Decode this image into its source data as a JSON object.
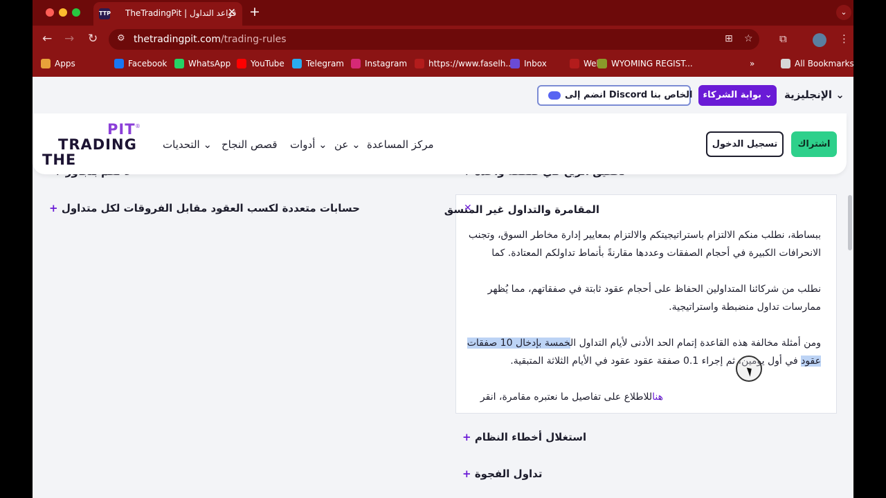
{
  "browser": {
    "tab_title": "TheTradingPit | قواعد التداول",
    "tab_favicon": "TTP",
    "url_host": "thetradingpit.com",
    "url_path": "/trading-rules",
    "bookmarks": [
      {
        "label": "Apps",
        "icon": "apps-icon",
        "color": "#e8a23a"
      },
      {
        "label": "Facebook",
        "icon": "facebook-icon",
        "color": "#1877f2"
      },
      {
        "label": "WhatsApp",
        "icon": "whatsapp-icon",
        "color": "#25d366"
      },
      {
        "label": "YouTube",
        "icon": "youtube-icon",
        "color": "#ff0000"
      },
      {
        "label": "Telegram",
        "icon": "telegram-icon",
        "color": "#2aabee"
      },
      {
        "label": "Instagram",
        "icon": "instagram-icon",
        "color": "#d62976"
      },
      {
        "label": "https://www.faselh...",
        "icon": "link-icon",
        "color": "#b31c1c"
      },
      {
        "label": "Inbox",
        "icon": "inbox-icon",
        "color": "#6a4bd6"
      },
      {
        "label": "Web",
        "icon": "web-icon",
        "color": "#b31c1c"
      },
      {
        "label": "WYOMING REGIST...",
        "icon": "wyoming-icon",
        "color": "#8a9a2a"
      },
      {
        "label": "All Bookmarks",
        "icon": "folder-icon",
        "color": "#d6d6d6"
      }
    ]
  },
  "topbar": {
    "language": "الإنجليزية",
    "partners": "بوابة الشركاء",
    "discord": "انضم إلى Discord الخاص بنا"
  },
  "header": {
    "logo_pit": "PIT",
    "logo_reg": "®",
    "logo_trading": "TRADING",
    "logo_the": "THE",
    "nav": [
      "مركز المساعدة",
      "عن",
      "أدوات",
      "قصص النجاح",
      "التحديات"
    ],
    "login": "تسجيل الدخول",
    "signup": "اشتراك"
  },
  "rules": {
    "peek_left": "لا تقم بتجاوز",
    "peek_right": "تحقيق الربح في صفقة واحدة",
    "multiple_accounts": "حسابات متعددة لكسب العقود مقابل الفروقات لكل متداول",
    "open_title": "المقامرة والتداول غير المتسق",
    "para1_line1": "ببساطة، نطلب منكم الالتزام باستراتيجيتكم والالتزام بمعايير إدارة مخاطر السوق، وتجنب",
    "para1_line2": "الانحرافات الكبيرة في أحجام الصفقات وعددها مقارنةً بأنماط تداولكم المعتادة. كما",
    "para2_line1": "نطلب من شركائنا المتداولين الحفاظ على أحجام عقود ثابتة في صفقاتهم، مما يُظهر",
    "para2_line2": "ممارسات تداول منضبطة واستراتيجية.",
    "para3_line1_start": "ومن أمثلة مخالفة هذه القاعدة إتمام الحد الأدنى لأيام التداول ال",
    "para3_line1_highlight": "خمسة بإدخال 10 صفقات",
    "para3_line2_highlight": "عقود",
    "para3_line2_rest": " في أول يومين، ثم إجراء 0.1 صفقة عقود عقود في الأيام الثلاثة المتبقية.",
    "para4_link": "هنا",
    "para4_rest": "للاطلاع على تفاصيل ما نعتبره مقامرة، انقر",
    "para4_end": ".",
    "exploit": "استغلال أخطاء النظام",
    "gap": "تداول الفجوة"
  }
}
